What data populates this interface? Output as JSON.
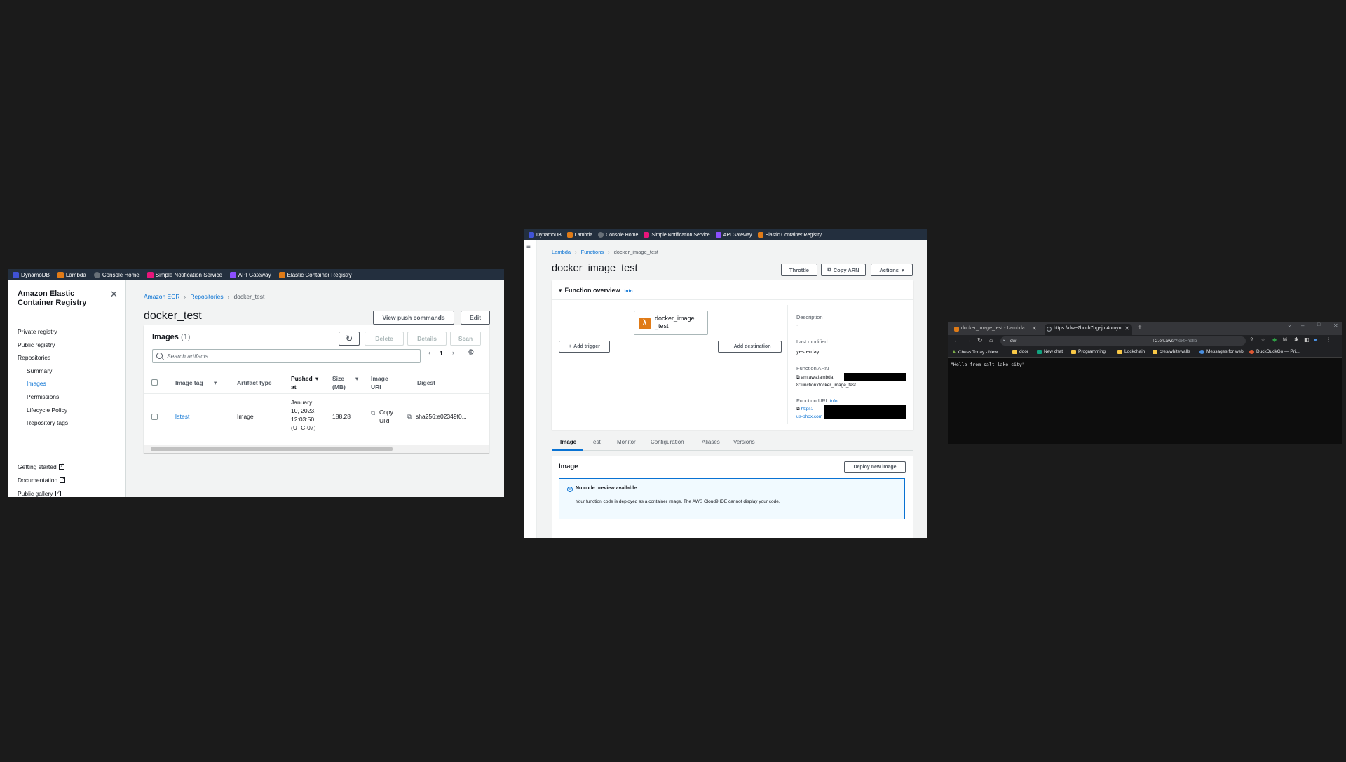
{
  "favorites": [
    {
      "label": "DynamoDB",
      "icon": "dynamodb-icon",
      "color": "#4053d6"
    },
    {
      "label": "Lambda",
      "icon": "lambda-icon",
      "color": "#e07b17"
    },
    {
      "label": "Console Home",
      "icon": "console-home-icon",
      "color": "#687078"
    },
    {
      "label": "Simple Notification Service",
      "icon": "sns-icon",
      "color": "#e7157b"
    },
    {
      "label": "API Gateway",
      "icon": "api-gateway-icon",
      "color": "#8c4fff"
    },
    {
      "label": "Elastic Container Registry",
      "icon": "ecr-icon",
      "color": "#e07b17"
    }
  ],
  "ecr": {
    "sidebar": {
      "title": "Amazon Elastic Container Registry",
      "items": [
        {
          "label": "Private registry",
          "sub": false,
          "active": false
        },
        {
          "label": "Public registry",
          "sub": false,
          "active": false
        },
        {
          "label": "Repositories",
          "sub": false,
          "active": false
        },
        {
          "label": "Summary",
          "sub": true,
          "active": false
        },
        {
          "label": "Images",
          "sub": true,
          "active": true
        },
        {
          "label": "Permissions",
          "sub": true,
          "active": false
        },
        {
          "label": "Lifecycle Policy",
          "sub": true,
          "active": false
        },
        {
          "label": "Repository tags",
          "sub": true,
          "active": false
        }
      ],
      "links": [
        "Getting started",
        "Documentation",
        "Public gallery"
      ]
    },
    "breadcrumb": [
      "Amazon ECR",
      "Repositories",
      "docker_test"
    ],
    "title": "docker_test",
    "buttons": {
      "view_push": "View push commands",
      "edit": "Edit"
    },
    "images": {
      "title": "Images",
      "count": "(1)",
      "actions": {
        "delete": "Delete",
        "details": "Details",
        "scan": "Scan"
      },
      "search_placeholder": "Search artifacts",
      "page": "1",
      "columns": {
        "tag": "Image tag",
        "artifact": "Artifact type",
        "pushed": "Pushed at",
        "size": "Size (MB)",
        "uri": "Image URI",
        "digest": "Digest"
      },
      "row": {
        "tag": "latest",
        "artifact": "Image",
        "pushed": "January 10, 2023, 12:03:50 (UTC-07)",
        "size": "188.28",
        "uri": "Copy URI",
        "digest": "sha256:e02349f0..."
      }
    }
  },
  "lambda": {
    "breadcrumb": [
      "Lambda",
      "Functions",
      "docker_image_test"
    ],
    "title": "docker_image_test",
    "buttons": {
      "throttle": "Throttle",
      "copy_arn": "Copy ARN",
      "actions": "Actions"
    },
    "overview": {
      "title": "Function overview",
      "info": "Info",
      "function_name": "docker_image _test",
      "add_trigger": "Add trigger",
      "add_destination": "Add destination",
      "description_label": "Description",
      "description_value": "-",
      "last_modified_label": "Last modified",
      "last_modified_value": "yesterday",
      "arn_label": "Function ARN",
      "arn_value_1": "arn:aws:lambda",
      "arn_value_2": "8:function:docker_image_test",
      "url_label": "Function URL",
      "url_info": "Info",
      "url_value_1": "https:/",
      "url_value_2": "us-phox.com"
    },
    "tabs": [
      "Image",
      "Test",
      "Monitor",
      "Configuration",
      "Aliases",
      "Versions"
    ],
    "image_section": {
      "title": "Image",
      "deploy": "Deploy new image",
      "alert_title": "No code preview available",
      "alert_body": "Your function code is deployed as a container image. The AWS Cloud9 IDE cannot display your code."
    }
  },
  "browser": {
    "tabs": [
      {
        "label": "docker_image_test - Lambda",
        "active": false
      },
      {
        "label": "https://dwe7bcch7hgejm4umyn",
        "active": true
      }
    ],
    "new_tab": "+",
    "url_start": "dw",
    "url_mid": "l-2.on.aws",
    "url_end": "/?text=hello",
    "bookmarks": [
      "Chess Today - New...",
      "door",
      "New chat",
      "Programming",
      "Lockchain",
      "cres/whitewalls",
      "Messages for web",
      "DuckDuckGo — Pri..."
    ],
    "body_text": "\"Hello from salt lake city\""
  }
}
